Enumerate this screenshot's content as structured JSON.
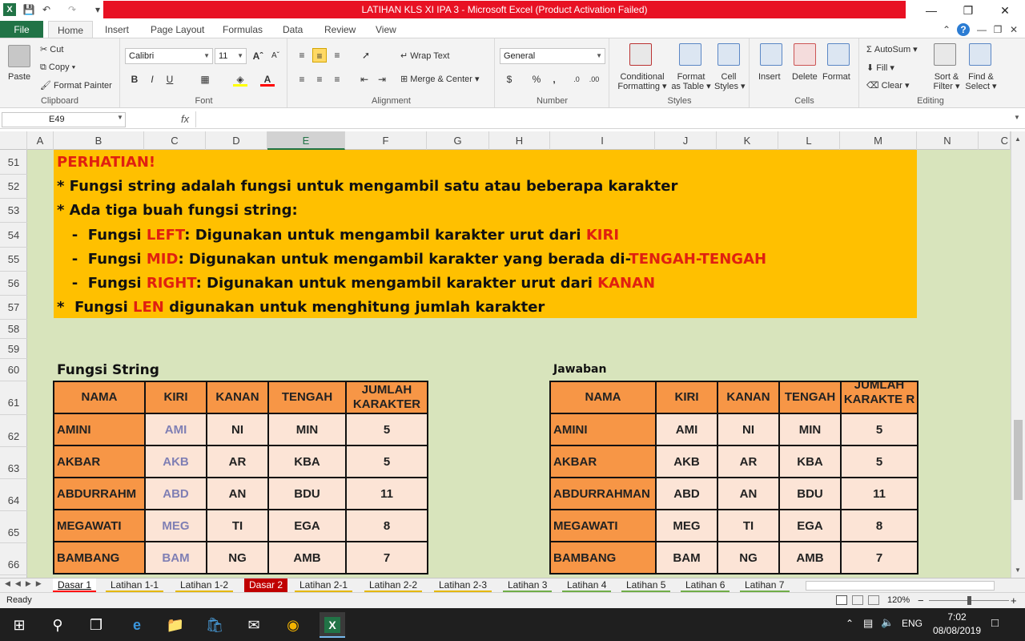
{
  "window": {
    "title": "LATIHAN KLS XI IPA 3  -  Microsoft Excel (Product Activation Failed)"
  },
  "ribbon_tabs": [
    "File",
    "Home",
    "Insert",
    "Page Layout",
    "Formulas",
    "Data",
    "Review",
    "View"
  ],
  "clipboard": {
    "paste": "Paste",
    "cut": "Cut",
    "copy": "Copy",
    "format_painter": "Format Painter",
    "label": "Clipboard"
  },
  "font": {
    "name": "Calibri",
    "size": "11",
    "label": "Font"
  },
  "alignment": {
    "wrap": "Wrap Text",
    "merge": "Merge & Center",
    "label": "Alignment"
  },
  "number": {
    "format": "General",
    "label": "Number"
  },
  "styles": {
    "cond": "Conditional",
    "cond2": "Formatting",
    "fmt_table": "Format",
    "fmt_table2": "as Table",
    "cell_styles": "Cell",
    "cell_styles2": "Styles",
    "label": "Styles"
  },
  "cells": {
    "insert": "Insert",
    "delete": "Delete",
    "format": "Format",
    "label": "Cells"
  },
  "editing": {
    "autosum": "AutoSum",
    "fill": "Fill",
    "clear": "Clear",
    "sort": "Sort &",
    "sort2": "Filter",
    "find": "Find &",
    "find2": "Select",
    "label": "Editing"
  },
  "formula_bar": {
    "name_box": "E49",
    "fx": "fx",
    "formula": ""
  },
  "columns": [
    "A",
    "B",
    "C",
    "D",
    "E",
    "F",
    "G",
    "H",
    "I",
    "J",
    "K",
    "L",
    "M",
    "N",
    "C"
  ],
  "rows": [
    "51",
    "52",
    "53",
    "54",
    "55",
    "56",
    "57",
    "58",
    "59",
    "60",
    "61",
    "62",
    "63",
    "64",
    "65",
    "66"
  ],
  "notes": {
    "heading": "PERHATIAN!",
    "l1": "*  Fungsi string adalah fungsi untuk mengambil satu atau beberapa karakter",
    "l2": "*  Ada tiga buah fungsi string:",
    "l3a": "   -  Fungsi ",
    "l3b": "LEFT",
    "l3c": ": Digunakan untuk mengambil karakter urut dari ",
    "l3d": "KIRI",
    "l4a": "   -  Fungsi ",
    "l4b": "MID",
    "l4c": ": Digunakan untuk mengambil karakter yang berada di-",
    "l4d": "TENGAH-TENGAH",
    "l5a": "   -  Fungsi ",
    "l5b": "RIGHT",
    "l5c": ": Digunakan untuk mengambil karakter urut dari ",
    "l5d": "KANAN",
    "l6a": "*  Fungsi ",
    "l6b": "LEN",
    "l6c": " digunakan untuk menghitung jumlah karakter"
  },
  "left_table": {
    "title": "Fungsi String",
    "headers": [
      "NAMA",
      "KIRI",
      "KANAN",
      "TENGAH",
      "JUMLAH KARAKTER"
    ],
    "rows": [
      [
        "AMINI",
        "AMI",
        "NI",
        "MIN",
        "5"
      ],
      [
        "AKBAR",
        "AKB",
        "AR",
        "KBA",
        "5"
      ],
      [
        "ABDURRAHM",
        "ABD",
        "AN",
        "BDU",
        "11"
      ],
      [
        "MEGAWATI",
        "MEG",
        "TI",
        "EGA",
        "8"
      ],
      [
        "BAMBANG",
        "BAM",
        "NG",
        "AMB",
        "7"
      ]
    ]
  },
  "right_table": {
    "title": "Jawaban",
    "headers": [
      "NAMA",
      "KIRI",
      "KANAN",
      "TENGAH",
      "JUMLAH KARAKTE R"
    ],
    "rows": [
      [
        "AMINI",
        "AMI",
        "NI",
        "MIN",
        "5"
      ],
      [
        "AKBAR",
        "AKB",
        "AR",
        "KBA",
        "5"
      ],
      [
        "ABDURRAHMAN",
        "ABD",
        "AN",
        "BDU",
        "11"
      ],
      [
        "MEGAWATI",
        "MEG",
        "TI",
        "EGA",
        "8"
      ],
      [
        "BAMBANG",
        "BAM",
        "NG",
        "AMB",
        "7"
      ]
    ]
  },
  "sheet_tabs": [
    "Dasar 1",
    "Latihan 1-1",
    "Latihan 1-2",
    "Dasar 2",
    "Latihan 2-1",
    "Latihan 2-2",
    "Latihan 2-3",
    "Latihan 3",
    "Latihan 4",
    "Latihan 5",
    "Latihan 6",
    "Latihan 7"
  ],
  "status": {
    "ready": "Ready",
    "zoom": "120%"
  },
  "taskbar": {
    "lang": "ENG",
    "time": "7:02",
    "date": "08/08/2019"
  },
  "colors": {
    "excel_green": "#217346",
    "note_bg": "#ffc000",
    "header_orange": "#f79646",
    "cell_peach": "#fce4d6",
    "sheet_bg": "#d8e4bc",
    "red_text": "#e02010"
  }
}
